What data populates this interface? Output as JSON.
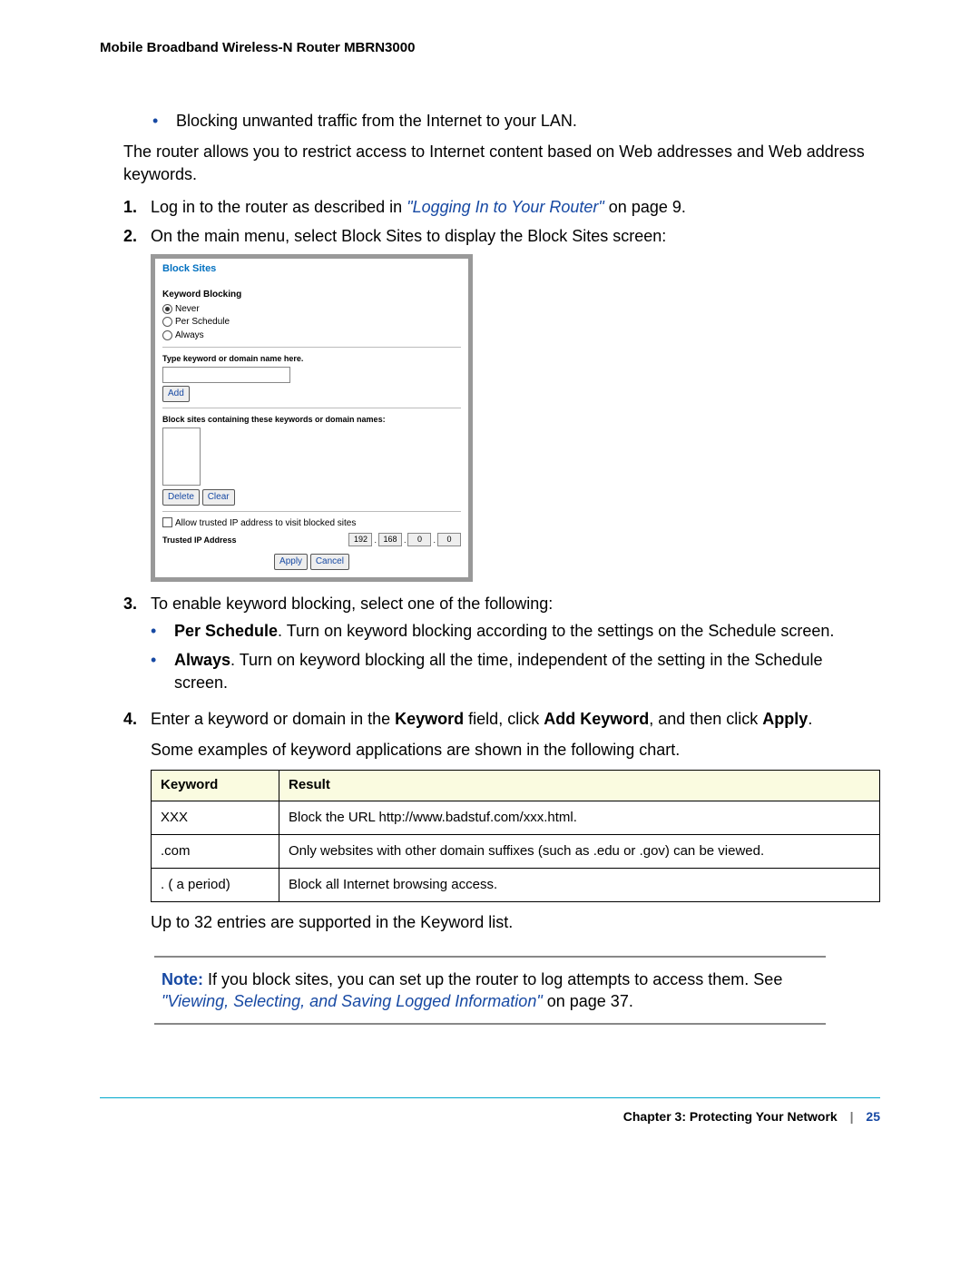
{
  "header": "Mobile Broadband Wireless-N Router MBRN3000",
  "intro_bullet": "Blocking unwanted traffic from the Internet to your LAN.",
  "intro_para": "The router allows you to restrict access to Internet content based on Web addresses and Web address keywords.",
  "steps": {
    "s1_pre": "Log in to the router as described in ",
    "s1_link": "\"Logging In to Your Router\"",
    "s1_post": " on page 9.",
    "s2": "On the main menu, select Block Sites to display the Block Sites screen:",
    "s3": "To enable keyword blocking, select one of the following:",
    "s3_b1_bold": "Per Schedule",
    "s3_b1_rest": ". Turn on keyword blocking according to the settings on the Schedule screen.",
    "s3_b2_bold": "Always",
    "s3_b2_rest": ". Turn on keyword blocking all the time, independent of the setting in the Schedule screen.",
    "s4_pre": "Enter a keyword or domain in the ",
    "s4_kw": "Keyword",
    "s4_mid1": " field, click ",
    "s4_add": "Add Keyword",
    "s4_mid2": ", and then click ",
    "s4_apply": "Apply",
    "s4_end": ".",
    "s4_para2": "Some examples of keyword applications are shown in the following chart.",
    "s4_limit": "Up to 32 entries are supported in the Keyword list."
  },
  "screenshot": {
    "title": "Block Sites",
    "keyword_blocking": "Keyword Blocking",
    "opt_never": "Never",
    "opt_per": "Per Schedule",
    "opt_always": "Always",
    "type_label": "Type keyword or domain name here.",
    "add_btn": "Add",
    "list_label": "Block sites containing these keywords or domain names:",
    "delete_btn": "Delete",
    "clear_btn": "Clear",
    "allow_cb": "Allow trusted IP address to visit blocked sites",
    "trusted_label": "Trusted IP Address",
    "ip": [
      "192",
      "168",
      "0",
      "0"
    ],
    "apply_btn": "Apply",
    "cancel_btn": "Cancel"
  },
  "table": {
    "h1": "Keyword",
    "h2": "Result",
    "rows": [
      {
        "k": "XXX",
        "r": "Block the URL http://www.badstuf.com/xxx.html."
      },
      {
        "k": ".com",
        "r": "Only websites with other domain suffixes (such as .edu or .gov) can be viewed."
      },
      {
        "k": ". ( a period)",
        "r": "Block all Internet browsing access."
      }
    ]
  },
  "note": {
    "label": "Note:",
    "pre": "  If you block sites, you can set up the router to log attempts to access them. See ",
    "link": "\"Viewing, Selecting, and Saving Logged Information\"",
    "post": " on page 37."
  },
  "footer": {
    "chapter": "Chapter 3:  Protecting Your Network",
    "sep": "|",
    "page": "25"
  }
}
